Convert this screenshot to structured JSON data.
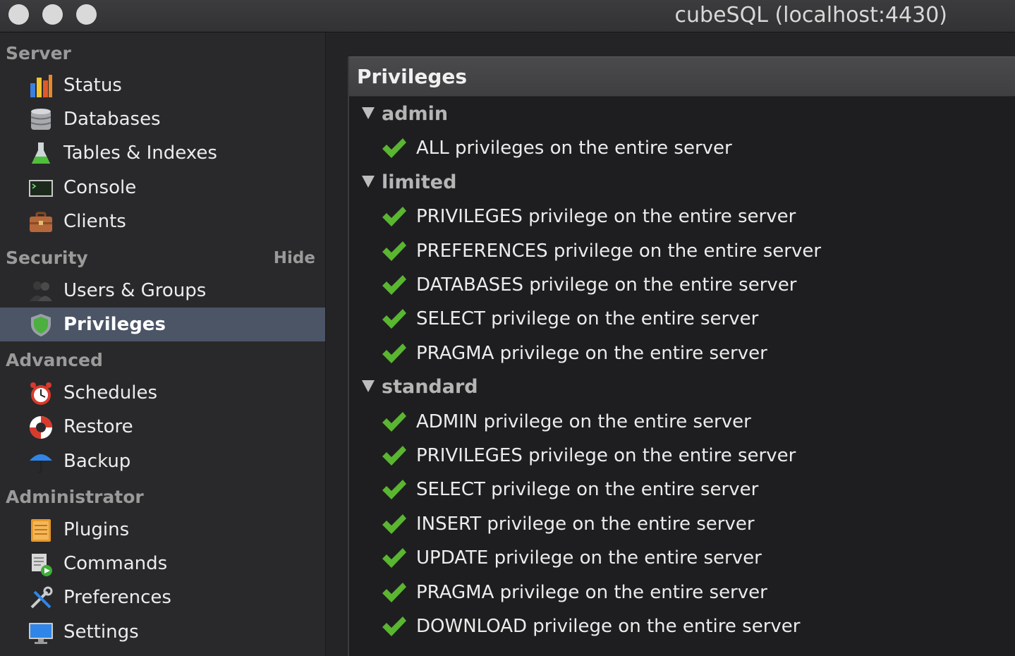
{
  "window": {
    "title": "cubeSQL (localhost:4430)"
  },
  "sidebar": {
    "sections": {
      "server": "Server",
      "security": "Security",
      "security_hide": "Hide",
      "advanced": "Advanced",
      "administrator": "Administrator"
    },
    "items": [
      {
        "label": "Status",
        "icon": "bar-chart-icon"
      },
      {
        "label": "Databases",
        "icon": "database-icon"
      },
      {
        "label": "Tables & Indexes",
        "icon": "flask-icon"
      },
      {
        "label": "Console",
        "icon": "terminal-icon"
      },
      {
        "label": "Clients",
        "icon": "briefcase-icon"
      },
      {
        "label": "Users & Groups",
        "icon": "users-icon"
      },
      {
        "label": "Privileges",
        "icon": "shield-icon",
        "selected": true
      },
      {
        "label": "Schedules",
        "icon": "alarm-clock-icon"
      },
      {
        "label": "Restore",
        "icon": "lifebuoy-icon"
      },
      {
        "label": "Backup",
        "icon": "umbrella-icon"
      },
      {
        "label": "Plugins",
        "icon": "plugin-icon"
      },
      {
        "label": "Commands",
        "icon": "script-icon"
      },
      {
        "label": "Preferences",
        "icon": "tools-icon"
      },
      {
        "label": "Settings",
        "icon": "monitor-icon"
      }
    ]
  },
  "main": {
    "title": "Privileges",
    "groups": [
      {
        "name": "admin",
        "privileges": [
          "ALL privileges on the entire server"
        ]
      },
      {
        "name": "limited",
        "privileges": [
          "PRIVILEGES privilege on the entire server",
          "PREFERENCES privilege on the entire server",
          "DATABASES privilege on the entire server",
          "SELECT privilege on the entire server",
          "PRAGMA privilege on the entire server"
        ]
      },
      {
        "name": "standard",
        "privileges": [
          "ADMIN privilege on the entire server",
          "PRIVILEGES privilege on the entire server",
          "SELECT privilege on the entire server",
          "INSERT privilege on the entire server",
          "UPDATE privilege on the entire server",
          "PRAGMA privilege on the entire server",
          "DOWNLOAD privilege on the entire server"
        ]
      }
    ]
  },
  "colors": {
    "selected_row": "#4b5566",
    "check_green": "#5ab531"
  }
}
